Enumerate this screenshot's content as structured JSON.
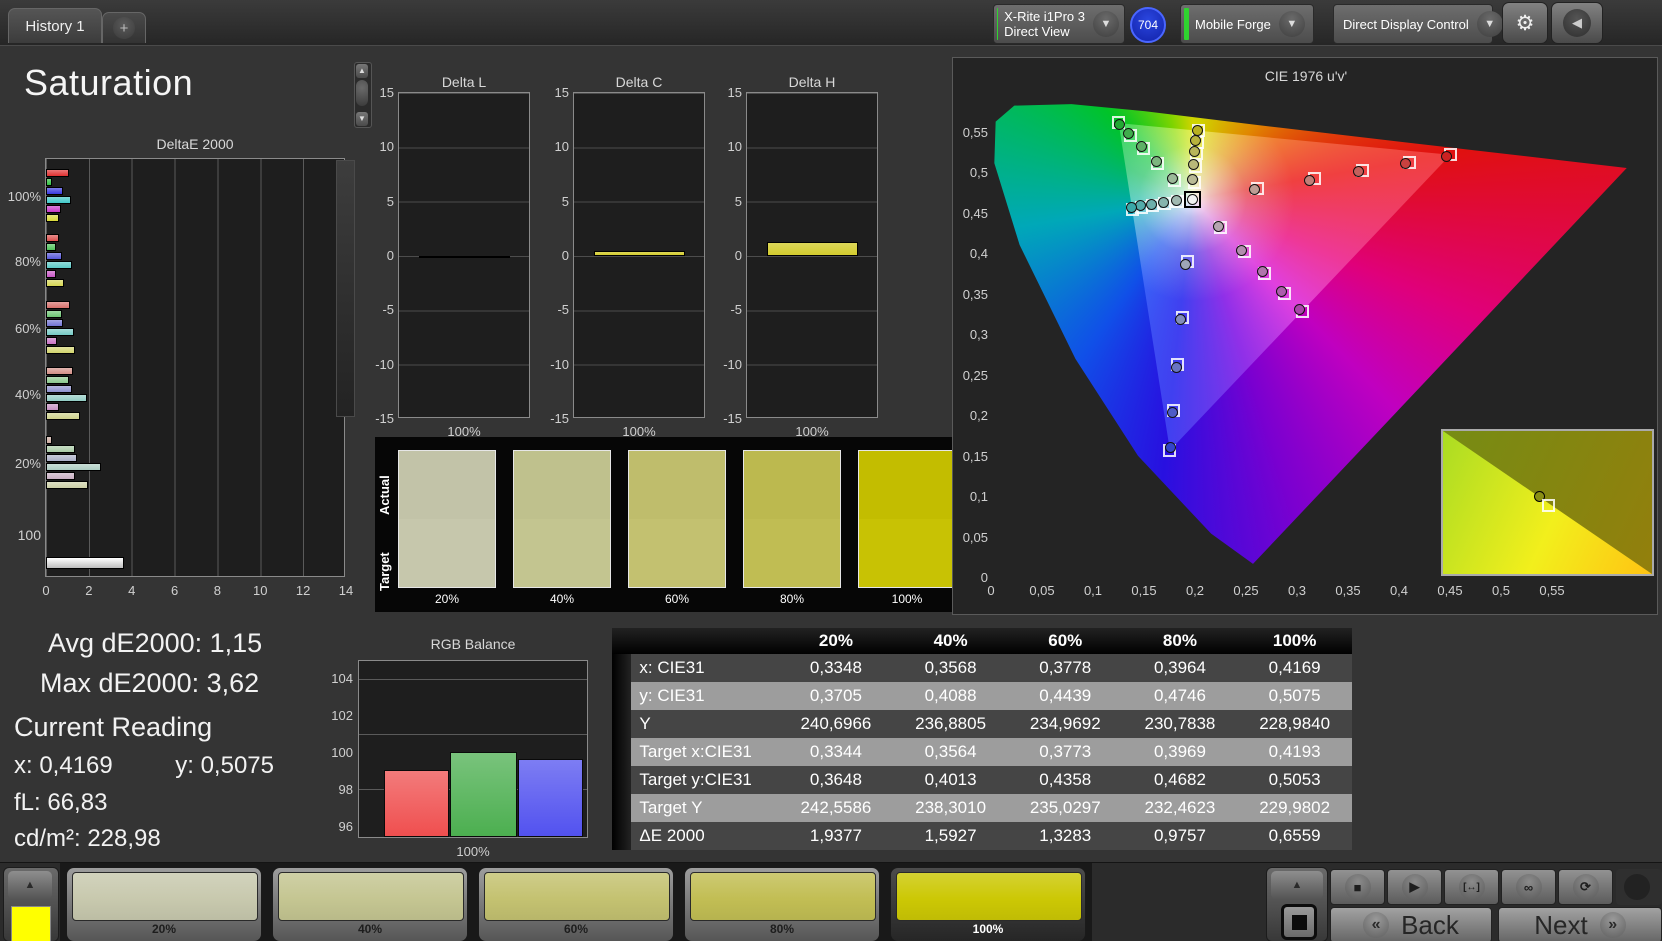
{
  "topbar": {
    "tab": "History 1",
    "add_tab": "+",
    "meter": {
      "line1": "X-Rite i1Pro 3",
      "line2": "Direct View",
      "indicator_color": "#2fd42f"
    },
    "badge": "704",
    "source": {
      "label": "Mobile Forge",
      "indicator_color": "#2fd42f"
    },
    "control": {
      "label": "Direct Display Control",
      "indicator_color": "#e8e800"
    }
  },
  "icons": {
    "chevron_down": "▼",
    "gear": "⚙",
    "collapse": "◀",
    "up": "▲",
    "down": "▼",
    "stop": "■",
    "play": "▶",
    "range": "[↔]",
    "infinity": "∞",
    "refresh": "⟳",
    "prev": "«",
    "next_arrow": "»"
  },
  "page_title": "Saturation",
  "de_chart": {
    "title": "DeltaE 2000",
    "x_ticks": [
      "0",
      "2",
      "4",
      "6",
      "8",
      "10",
      "12",
      "14"
    ],
    "xmax": 14,
    "series_colors": [
      "#e03030",
      "#30c040",
      "#3838e0",
      "#40c8c8",
      "#c838c8",
      "#d8d838"
    ],
    "groups": [
      {
        "label": "100%",
        "values": [
          1.05,
          0.3,
          0.8,
          1.15,
          0.7,
          0.6
        ],
        "sat": 1.0
      },
      {
        "label": "80%",
        "values": [
          0.6,
          0.45,
          0.75,
          1.2,
          0.45,
          0.85
        ],
        "sat": 0.8
      },
      {
        "label": "60%",
        "values": [
          1.1,
          0.75,
          0.8,
          1.3,
          0.5,
          1.35
        ],
        "sat": 0.6
      },
      {
        "label": "40%",
        "values": [
          1.25,
          1.05,
          1.2,
          1.9,
          0.6,
          1.6
        ],
        "sat": 0.4
      },
      {
        "label": "20%",
        "values": [
          0.3,
          1.35,
          1.45,
          2.55,
          1.35,
          1.95
        ],
        "sat": 0.2
      }
    ],
    "white_group": {
      "label": "100",
      "value": 3.62,
      "color": "#f5f5f5"
    }
  },
  "delta_charts": {
    "y_ticks": [
      "15",
      "10",
      "5",
      "0",
      "-5",
      "-10",
      "-15"
    ],
    "ymax": 15,
    "charts": [
      {
        "title": "Delta L",
        "value": -0.15,
        "color": "#050505",
        "x_label": "100%"
      },
      {
        "title": "Delta C",
        "value": 0.5,
        "color": "#d3cc2e",
        "x_label": "100%"
      },
      {
        "title": "Delta H",
        "value": 1.3,
        "color": "#d3cc2e",
        "x_label": "100%"
      }
    ]
  },
  "swatch_strip": {
    "row_labels": [
      "Actual",
      "Target"
    ],
    "items": [
      {
        "label": "20%",
        "actual": "#c2c3a8",
        "target": "#c6c7ac"
      },
      {
        "label": "40%",
        "actual": "#bfc18d",
        "target": "#c3c590"
      },
      {
        "label": "60%",
        "actual": "#bfbd6c",
        "target": "#c3c170"
      },
      {
        "label": "80%",
        "actual": "#bcb94f",
        "target": "#c0bd53"
      },
      {
        "label": "100%",
        "actual": "#c3bd00",
        "target": "#c8c204"
      }
    ]
  },
  "cie": {
    "title": "CIE 1976 u'v'",
    "y_ticks": [
      "0,55",
      "0,5",
      "0,45",
      "0,4",
      "0,35",
      "0,3",
      "0,25",
      "0,2",
      "0,15",
      "0,1",
      "0,05",
      "0"
    ],
    "x_ticks": [
      "0",
      "0,05",
      "0,1",
      "0,15",
      "0,2",
      "0,25",
      "0,3",
      "0,35",
      "0,4",
      "0,45",
      "0,5",
      "0,55"
    ],
    "white_point": [
      0.1978,
      0.4683
    ],
    "series": [
      {
        "name": "red",
        "color": "#cc2222",
        "targets": [
          [
            0.261,
            0.482
          ],
          [
            0.3167,
            0.494
          ],
          [
            0.3647,
            0.5043
          ],
          [
            0.4103,
            0.5142
          ],
          [
            0.4507,
            0.5229
          ]
        ],
        "measured": [
          [
            0.258,
            0.48
          ],
          [
            0.312,
            0.4915
          ],
          [
            0.36,
            0.502
          ],
          [
            0.406,
            0.512
          ],
          [
            0.447,
            0.5215
          ]
        ]
      },
      {
        "name": "green",
        "color": "#22a833",
        "targets": [
          [
            0.1796,
            0.4919
          ],
          [
            0.1636,
            0.5126
          ],
          [
            0.1498,
            0.5305
          ],
          [
            0.1366,
            0.5474
          ],
          [
            0.125,
            0.5625
          ]
        ],
        "measured": [
          [
            0.178,
            0.494
          ],
          [
            0.162,
            0.515
          ],
          [
            0.148,
            0.533
          ],
          [
            0.135,
            0.549
          ],
          [
            0.126,
            0.56
          ]
        ]
      },
      {
        "name": "blue",
        "color": "#3344cc",
        "targets": [
          [
            0.1922,
            0.3907
          ],
          [
            0.1873,
            0.3224
          ],
          [
            0.183,
            0.2634
          ],
          [
            0.179,
            0.2076
          ],
          [
            0.1754,
            0.1579
          ]
        ],
        "measured": [
          [
            0.1905,
            0.388
          ],
          [
            0.186,
            0.319
          ],
          [
            0.1815,
            0.26
          ],
          [
            0.1778,
            0.205
          ],
          [
            0.176,
            0.161
          ]
        ]
      },
      {
        "name": "cyan",
        "color": "#3aa8a8",
        "targets": [
          [
            0.183,
            0.4651
          ],
          [
            0.1699,
            0.4623
          ],
          [
            0.1586,
            0.4599
          ],
          [
            0.1479,
            0.4575
          ],
          [
            0.1384,
            0.4555
          ]
        ],
        "measured": [
          [
            0.182,
            0.467
          ],
          [
            0.169,
            0.4645
          ],
          [
            0.1575,
            0.462
          ],
          [
            0.147,
            0.46
          ],
          [
            0.138,
            0.458
          ]
        ]
      },
      {
        "name": "magenta",
        "color": "#aa44aa",
        "targets": [
          [
            0.2246,
            0.4337
          ],
          [
            0.2482,
            0.4033
          ],
          [
            0.2686,
            0.377
          ],
          [
            0.2878,
            0.3521
          ],
          [
            0.305,
            0.33
          ]
        ],
        "measured": [
          [
            0.223,
            0.435
          ],
          [
            0.246,
            0.405
          ],
          [
            0.266,
            0.379
          ],
          [
            0.285,
            0.354
          ],
          [
            0.302,
            0.332
          ]
        ]
      },
      {
        "name": "yellow",
        "color": "#b8b020",
        "targets": [
          [
            0.1994,
            0.4894
          ],
          [
            0.2007,
            0.5085
          ],
          [
            0.2019,
            0.5247
          ],
          [
            0.2029,
            0.5385
          ],
          [
            0.2039,
            0.5529
          ]
        ],
        "measured": [
          [
            0.1976,
            0.4921
          ],
          [
            0.1984,
            0.5116
          ],
          [
            0.1996,
            0.5277
          ],
          [
            0.2007,
            0.5405
          ],
          [
            0.202,
            0.5532
          ]
        ]
      }
    ]
  },
  "stats": {
    "avg": "Avg dE2000: 1,15",
    "max": "Max dE2000: 3,62",
    "current": "Current Reading",
    "x": "x: 0,4169",
    "y": "y: 0,5075",
    "fl": "fL: 66,83",
    "cd": "cd/m²: 228,98"
  },
  "rgb_chart": {
    "title": "RGB Balance",
    "x_label": "100%",
    "y_ticks": [
      "104",
      "102",
      "100",
      "98",
      "96"
    ],
    "bars": [
      {
        "name": "red",
        "value": 99.1,
        "color": "#ef4f4f"
      },
      {
        "name": "green",
        "value": 100.05,
        "color": "#4caf50"
      },
      {
        "name": "blue",
        "value": 99.65,
        "color": "#5252ef"
      }
    ]
  },
  "table": {
    "col_headers": [
      "",
      "20%",
      "40%",
      "60%",
      "80%",
      "100%"
    ],
    "rows": [
      {
        "label": "x: CIE31",
        "values": [
          "0,3348",
          "0,3568",
          "0,3778",
          "0,3964",
          "0,4169"
        ]
      },
      {
        "label": "y: CIE31",
        "values": [
          "0,3705",
          "0,4088",
          "0,4439",
          "0,4746",
          "0,5075"
        ]
      },
      {
        "label": "Y",
        "values": [
          "240,6966",
          "236,8805",
          "234,9692",
          "230,7838",
          "228,9840"
        ]
      },
      {
        "label": "Target x:CIE31",
        "values": [
          "0,3344",
          "0,3564",
          "0,3773",
          "0,3969",
          "0,4193"
        ]
      },
      {
        "label": "Target y:CIE31",
        "values": [
          "0,3648",
          "0,4013",
          "0,4358",
          "0,4682",
          "0,5053"
        ]
      },
      {
        "label": "Target Y",
        "values": [
          "242,5586",
          "238,3010",
          "235,0297",
          "232,4623",
          "229,9802"
        ]
      },
      {
        "label": "ΔE 2000",
        "values": [
          "1,9377",
          "1,5927",
          "1,3283",
          "0,9757",
          "0,6559"
        ]
      }
    ]
  },
  "bottombar": {
    "swatches": [
      {
        "label": "20%",
        "color": "#c8c9ae",
        "selected": false
      },
      {
        "label": "40%",
        "color": "#c5c692",
        "selected": false
      },
      {
        "label": "60%",
        "color": "#c4c271",
        "selected": false
      },
      {
        "label": "80%",
        "color": "#c2be54",
        "selected": false
      },
      {
        "label": "100%",
        "color": "#ccc805",
        "selected": true
      }
    ],
    "back": "Back",
    "next": "Next"
  }
}
